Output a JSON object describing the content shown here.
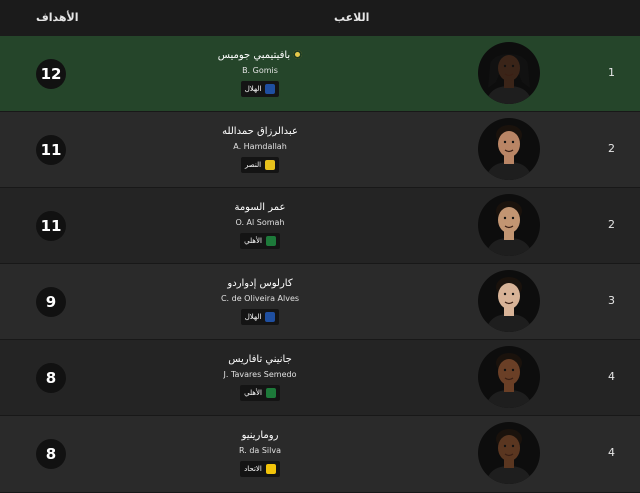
{
  "header": {
    "goals_label": "الأهداف",
    "player_label": "اللاعب"
  },
  "colors": {
    "top_row": "#25452a",
    "crest_hilal": "#1f4fa0",
    "crest_nassr": "#e8c21c",
    "crest_ahli": "#1d7a3a",
    "crest_ittihad": "#f2c40a"
  },
  "players": [
    {
      "rank": "1",
      "goals": "12",
      "name_ar": "بافيتيمبي جوميس",
      "name_en": "B. Gomis",
      "club": "الهلال",
      "crest": "hilal-crest-icon",
      "skin": "#3a2418",
      "hair": "dreadlocks",
      "top_scorer_icon": "ball-icon"
    },
    {
      "rank": "2",
      "goals": "11",
      "name_ar": "عبدالرزاق حمدالله",
      "name_en": "A. Hamdallah",
      "club": "النصر",
      "crest": "nassr-crest-icon",
      "skin": "#b98565",
      "hair": "short"
    },
    {
      "rank": "2",
      "goals": "11",
      "name_ar": "عمر السومة",
      "name_en": "O. Al Somah",
      "club": "الأهلي",
      "crest": "ahli-crest-icon",
      "skin": "#c29572",
      "hair": "short"
    },
    {
      "rank": "3",
      "goals": "9",
      "name_ar": "كارلوس إدواردو",
      "name_en": "C. de Oliveira Alves",
      "club": "الهلال",
      "crest": "hilal-crest-icon",
      "skin": "#d8b397",
      "hair": "short"
    },
    {
      "rank": "4",
      "goals": "8",
      "name_ar": "جانيني تافاريس",
      "name_en": "J. Tavares Semedo",
      "club": "الأهلي",
      "crest": "ahli-crest-icon",
      "skin": "#6a3f26",
      "hair": "short"
    },
    {
      "rank": "4",
      "goals": "8",
      "name_ar": "رومارينيو",
      "name_en": "R. da Silva",
      "club": "الاتحاد",
      "crest": "ittihad-crest-icon",
      "skin": "#5a3620",
      "hair": "short"
    }
  ]
}
